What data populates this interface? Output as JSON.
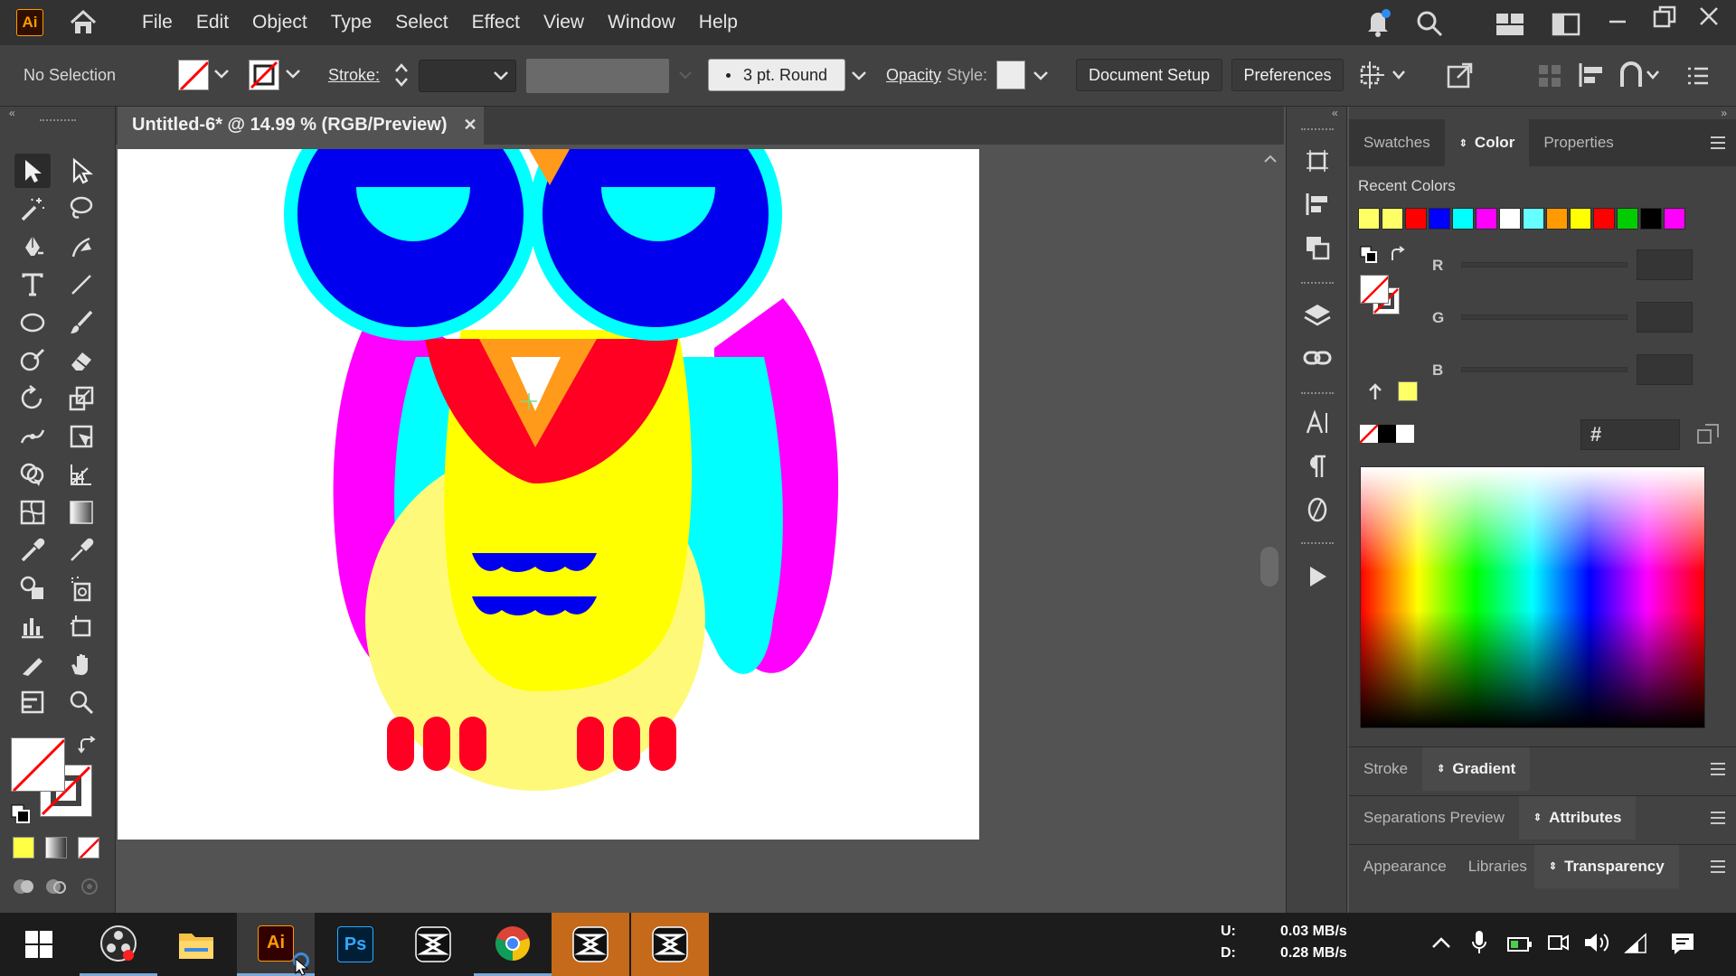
{
  "app": {
    "logo_text": "Ai",
    "brand_color": "#ff9a00"
  },
  "menu": [
    "File",
    "Edit",
    "Object",
    "Type",
    "Select",
    "Effect",
    "View",
    "Window",
    "Help"
  ],
  "control_bar": {
    "selection_status": "No Selection",
    "stroke_label": "Stroke:",
    "brush_label": "3 pt. Round",
    "opacity_label": "Opacity",
    "style_label": "Style:",
    "document_setup": "Document Setup",
    "preferences": "Preferences"
  },
  "document_tab": {
    "title": "Untitled-6* @ 14.99 % (RGB/Preview)",
    "close_glyph": "✕"
  },
  "panels": {
    "top_tabs": {
      "swatches": "Swatches",
      "color": "Color",
      "properties": "Properties"
    },
    "recent_colors_label": "Recent Colors",
    "recent_colors": [
      "#ffff66",
      "#ffff66",
      "#ff0000",
      "#0000ff",
      "#00ffff",
      "#ff00ff",
      "#ffffff",
      "#66ffff",
      "#ff9a00",
      "#ffff00",
      "#ff0000",
      "#00cc00",
      "#000000",
      "#ff00ff"
    ],
    "channels": {
      "r": "R",
      "g": "G",
      "b": "B"
    },
    "hex_label": "#",
    "stroke_tab": "Stroke",
    "gradient_tab": "Gradient",
    "separations_tab": "Separations Preview",
    "attributes_tab": "Attributes",
    "appearance_tab": "Appearance",
    "libraries_tab": "Libraries",
    "transparency_tab": "Transparency"
  },
  "taskbar": {
    "net_up_label": "U:",
    "net_up_value": "0.03 MB/s",
    "net_down_label": "D:",
    "net_down_value": "0.28 MB/s",
    "ps_text": "Ps",
    "ai_text": "Ai"
  },
  "owl_colors": {
    "blue": "#0000ee",
    "cyan": "#00ffff",
    "magenta": "#ff00ff",
    "yellow": "#ffff00",
    "pale_yellow": "#fff97a",
    "red": "#ff0022",
    "orange": "#ff9a1a"
  }
}
